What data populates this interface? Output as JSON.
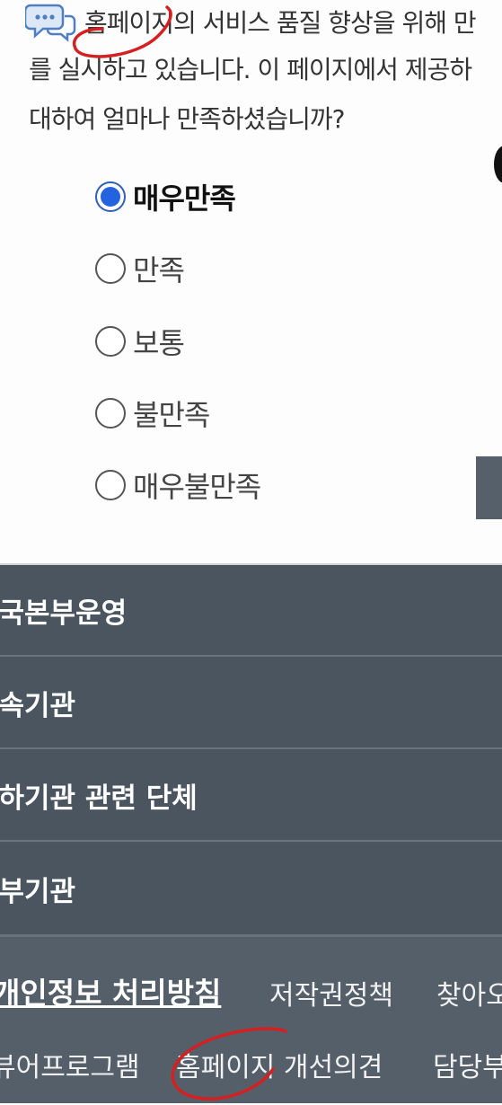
{
  "survey": {
    "question_lines": [
      "홈페이지의 서비스 품질 향상을 위해 만",
      "를 실시하고 있습니다. 이 페이지에서 제공하",
      "대하여 얼마나 만족하셨습니까?"
    ],
    "options": [
      {
        "label": "매우만족",
        "selected": true
      },
      {
        "label": "만족",
        "selected": false
      },
      {
        "label": "보통",
        "selected": false
      },
      {
        "label": "불만족",
        "selected": false
      },
      {
        "label": "매우불만족",
        "selected": false
      }
    ]
  },
  "nav": {
    "items": [
      {
        "label": "실국본부운영"
      },
      {
        "label": "소속기관"
      },
      {
        "label": "산하기관 관련 단체"
      },
      {
        "label": "정부기관"
      }
    ]
  },
  "footer": {
    "row1": [
      "개인정보 처리방침",
      "저작권정책",
      "찾아오"
    ],
    "row2": [
      "뷰어프로그램",
      "홈페이지 개선의견",
      "담당부"
    ]
  },
  "colors": {
    "accent": "#2463e0",
    "annotation": "#d42020",
    "nav_bg": "#4a5560",
    "footer_bg": "#545f6a"
  }
}
